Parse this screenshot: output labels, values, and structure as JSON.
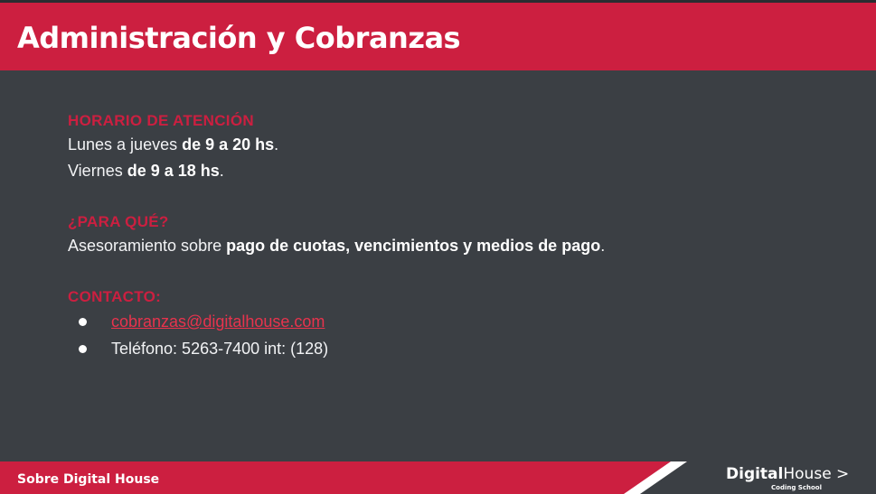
{
  "header": {
    "title": "Administración y Cobranzas"
  },
  "schedule": {
    "title": "HORARIO DE ATENCIÓN",
    "line1_prefix": "Lunes a jueves ",
    "line1_bold": "de 9 a 20 hs",
    "line1_suffix": ".",
    "line2_prefix": "Viernes ",
    "line2_bold": "de 9 a 18 hs",
    "line2_suffix": "."
  },
  "purpose": {
    "title": "¿PARA QUÉ?",
    "text_prefix": "Asesoramiento sobre ",
    "text_bold": "pago de cuotas, vencimientos y medios de pago",
    "text_suffix": "."
  },
  "contact": {
    "title": "CONTACTO:",
    "email": "cobranzas@digitalhouse.com",
    "phone": "Teléfono: 5263-7400 int: (128)"
  },
  "footer": {
    "label": "Sobre Digital House",
    "logo_part1": "Digital",
    "logo_part2": "House >",
    "logo_sub": "Coding School"
  },
  "colors": {
    "accent": "#cc1f40",
    "background": "#3b3f44"
  }
}
